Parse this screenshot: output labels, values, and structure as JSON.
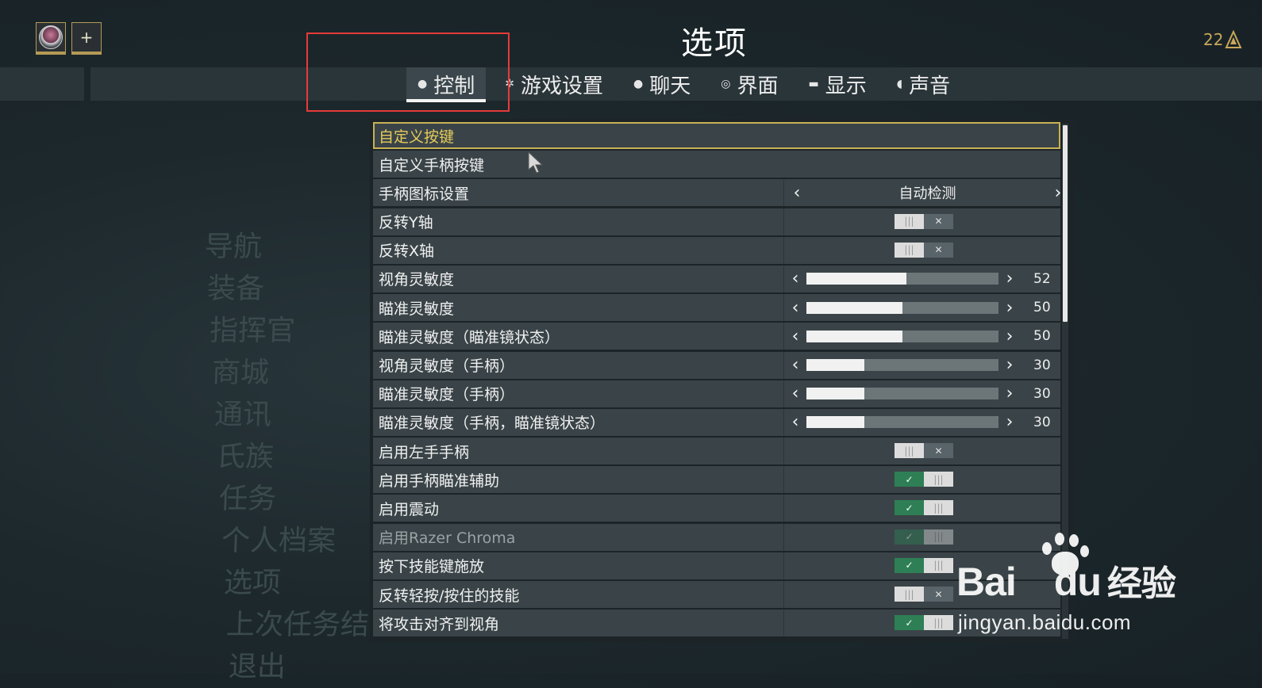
{
  "header": {
    "title": "选项",
    "plus_label": "+",
    "corner_number": "22"
  },
  "background_menu": [
    "导航",
    "装备",
    "指挥官",
    "商城",
    "通讯",
    "氏族",
    "任务",
    "个人档案",
    "选项",
    "上次任务结果",
    "退出"
  ],
  "tabs": [
    {
      "label": "控制",
      "icon": "mouse-icon",
      "active": true
    },
    {
      "label": "游戏设置",
      "icon": "gear-icon"
    },
    {
      "label": "聊天",
      "icon": "chat-bubble-icon"
    },
    {
      "label": "界面",
      "icon": "interface-icon"
    },
    {
      "label": "显示",
      "icon": "monitor-icon"
    },
    {
      "label": "声音",
      "icon": "speaker-icon"
    }
  ],
  "settings": [
    {
      "label": "自定义按键",
      "type": "link",
      "selected": true
    },
    {
      "label": "自定义手柄按键",
      "type": "link"
    },
    {
      "label": "手柄图标设置",
      "type": "select",
      "value": "自动检测"
    },
    {
      "label": "反转Y轴",
      "type": "toggle",
      "on": false
    },
    {
      "label": "反转X轴",
      "type": "toggle",
      "on": false
    },
    {
      "label": "视角灵敏度",
      "type": "slider",
      "value": "52",
      "fraction": 0.52
    },
    {
      "label": "瞄准灵敏度",
      "type": "slider",
      "value": "50",
      "fraction": 0.5
    },
    {
      "label": "瞄准灵敏度（瞄准镜状态）",
      "type": "slider",
      "value": "50",
      "fraction": 0.5
    },
    {
      "label": "视角灵敏度（手柄）",
      "type": "slider",
      "value": "30",
      "fraction": 0.3
    },
    {
      "label": "瞄准灵敏度（手柄）",
      "type": "slider",
      "value": "30",
      "fraction": 0.3
    },
    {
      "label": "瞄准灵敏度（手柄，瞄准镜状态）",
      "type": "slider",
      "value": "30",
      "fraction": 0.3
    },
    {
      "label": "启用左手手柄",
      "type": "toggle",
      "on": false
    },
    {
      "label": "启用手柄瞄准辅助",
      "type": "toggle",
      "on": true
    },
    {
      "label": "启用震动",
      "type": "toggle",
      "on": true
    },
    {
      "label": "启用Razer Chroma",
      "type": "toggle",
      "on": true,
      "disabled": true
    },
    {
      "label": "按下技能键施放",
      "type": "toggle",
      "on": true
    },
    {
      "label": "反转轻按/按住的技能",
      "type": "toggle",
      "on": false
    },
    {
      "label": "将攻击对齐到视角",
      "type": "toggle",
      "on": true
    }
  ],
  "watermark": {
    "brand": "Bai",
    "brand_suffix": "du",
    "brand_cn": "经验",
    "url": "jingyan.baidu.com"
  },
  "colors": {
    "accent_gold": "#c9b154",
    "toggle_on": "#2e7f55",
    "annotation_red": "#e53a3a"
  }
}
